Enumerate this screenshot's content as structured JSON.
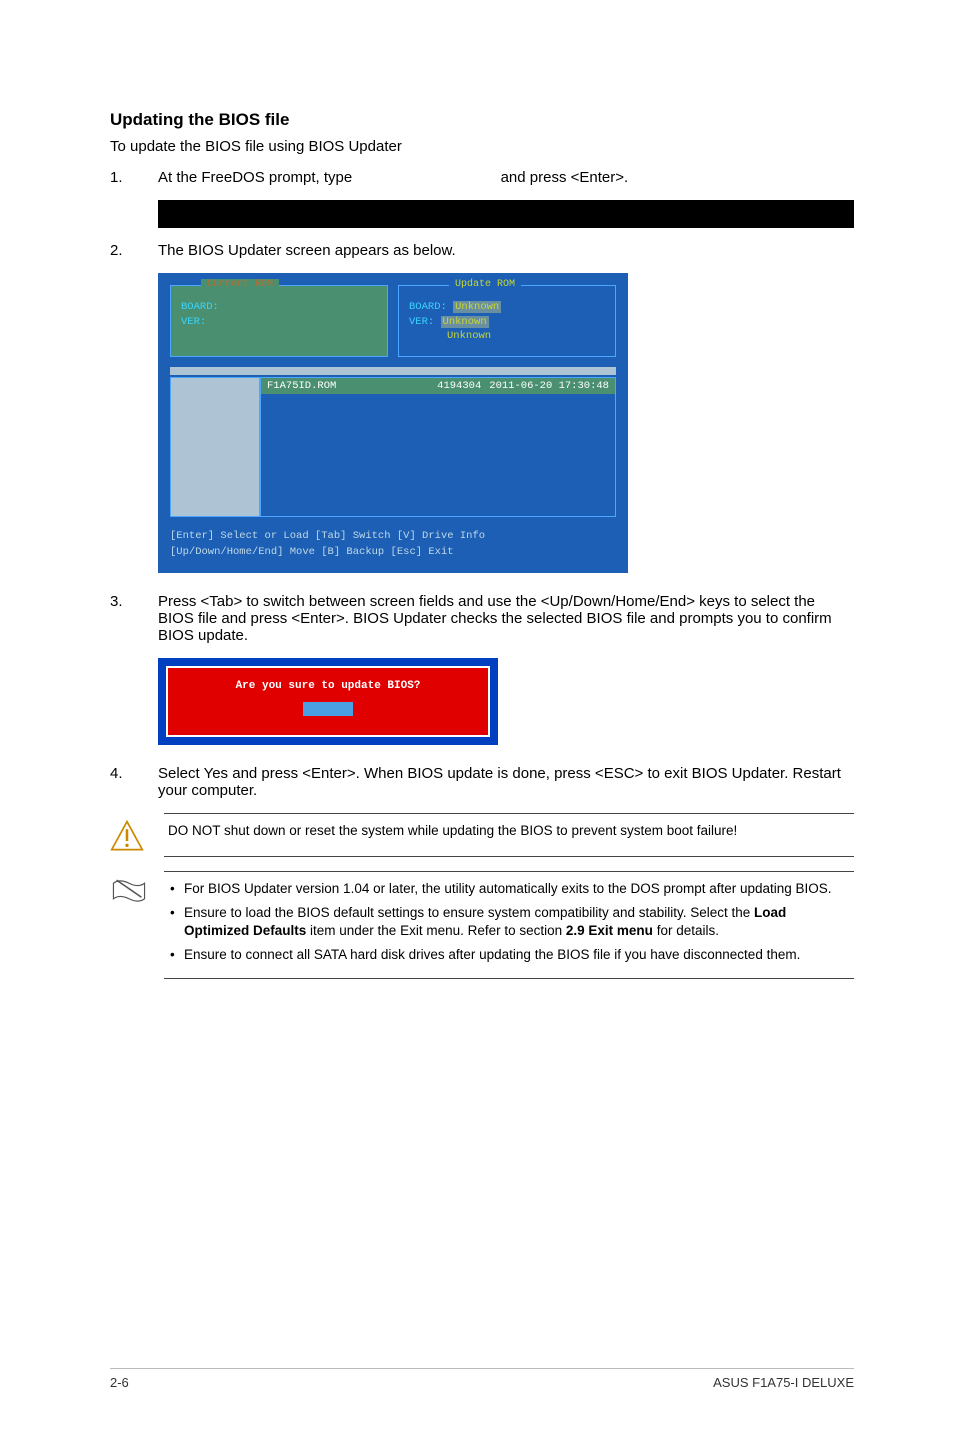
{
  "title": "Updating the BIOS file",
  "intro": "To update the BIOS file using BIOS Updater",
  "steps": {
    "s1": {
      "num": "1.",
      "pre": "At the FreeDOS prompt, type",
      "post": "and press <Enter>."
    },
    "s2": {
      "num": "2.",
      "text": "The BIOS Updater screen appears as below."
    },
    "s3": {
      "num": "3.",
      "text": "Press <Tab> to switch between screen fields and use the <Up/Down/Home/End> keys to select the BIOS file and press <Enter>. BIOS Updater checks the selected BIOS file and prompts you to confirm BIOS update."
    },
    "s4": {
      "num": "4.",
      "text": "Select Yes and press <Enter>. When BIOS update is done, press <ESC> to exit BIOS Updater. Restart your computer."
    }
  },
  "bios": {
    "current_legend": "Current ROM",
    "update_legend": "Update ROM",
    "board_label": "BOARD:",
    "ver_label": "VER:",
    "unknown": "Unknown",
    "file": {
      "name": "F1A75ID.ROM",
      "size": "4194304",
      "datetime": "2011-06-20 17:30:48"
    },
    "footer": {
      "l1": "[Enter] Select or Load   [Tab] Switch   [V] Drive Info",
      "l2": "[Up/Down/Home/End] Move  [B] Backup    [Esc] Exit"
    }
  },
  "confirm": {
    "question": "Are you sure to update BIOS?"
  },
  "warning": "DO NOT shut down or reset the system while updating the BIOS to prevent system boot failure!",
  "notes": {
    "n1": "For BIOS Updater version 1.04 or later, the utility automatically exits to the DOS prompt after updating BIOS.",
    "n2_pre": "Ensure to load the BIOS default settings to ensure system compatibility and stability. Select the ",
    "n2_bold1": "Load Optimized Defaults",
    "n2_mid": " item under the Exit menu. Refer to section ",
    "n2_bold2": "2.9 Exit menu",
    "n2_post": " for details.",
    "n3": "Ensure to connect all SATA hard disk drives after updating the BIOS file if you have disconnected them."
  },
  "footer": {
    "page": "2-6",
    "product": "ASUS F1A75-I DELUXE"
  }
}
